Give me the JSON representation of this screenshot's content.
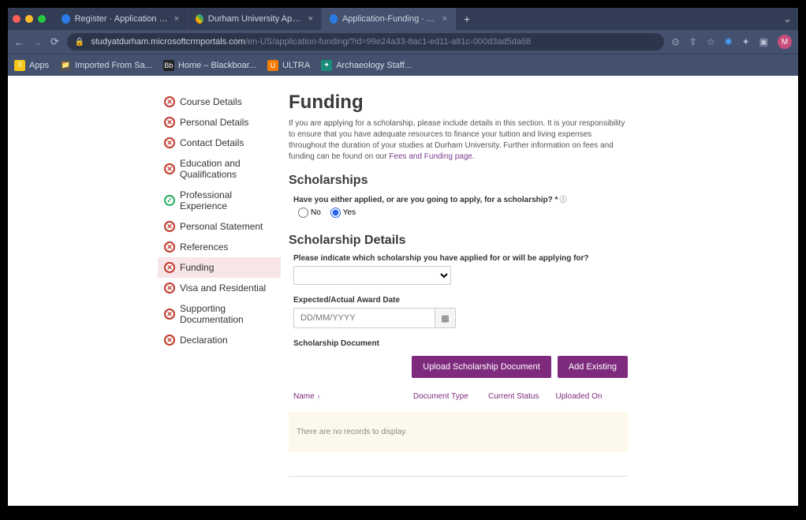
{
  "browser": {
    "tabs": [
      {
        "title": "Register · Application Portal",
        "active": false
      },
      {
        "title": "Durham University Applicant P",
        "active": false
      },
      {
        "title": "Application-Funding · Applicat",
        "active": true
      }
    ],
    "url_host": "studyatdurham.microsoftcrmportals.com",
    "url_path": "/en-US/application-funding/?id=99e24a33-8ac1-ed11-a81c-000d3ad5da68",
    "avatar_letter": "M",
    "bookmarks": [
      {
        "label": "Apps"
      },
      {
        "label": "Imported From Sa..."
      },
      {
        "label": "Home – Blackboar..."
      },
      {
        "label": "ULTRA"
      },
      {
        "label": "Archaeology Staff..."
      }
    ]
  },
  "sidebar": {
    "items": [
      {
        "label": "Course Details",
        "status": "err"
      },
      {
        "label": "Personal Details",
        "status": "err"
      },
      {
        "label": "Contact Details",
        "status": "err"
      },
      {
        "label": "Education and Qualifications",
        "status": "err"
      },
      {
        "label": "Professional Experience",
        "status": "ok"
      },
      {
        "label": "Personal Statement",
        "status": "err"
      },
      {
        "label": "References",
        "status": "err"
      },
      {
        "label": "Funding",
        "status": "err",
        "active": true
      },
      {
        "label": "Visa and Residential",
        "status": "err"
      },
      {
        "label": "Supporting Documentation",
        "status": "err"
      },
      {
        "label": "Declaration",
        "status": "err"
      }
    ]
  },
  "main": {
    "title": "Funding",
    "description": "If you are applying for a scholarship, please include details in this section. It is your responsibility to ensure that you have adequate resources to finance your tuition and living expenses throughout the duration of your studies at Durham University. Further information on fees and funding can be found on our ",
    "description_link": "Fees and Funding page",
    "section1_title": "Scholarships",
    "q1_label": "Have you either applied, or are you going to apply, for a scholarship? *",
    "q1_no": "No",
    "q1_yes": "Yes",
    "section2_title": "Scholarship Details",
    "q2_label": "Please indicate which scholarship you have applied for or will be applying for?",
    "date_label": "Expected/Actual Award Date",
    "date_placeholder": "DD/MM/YYYY",
    "doc_label": "Scholarship Document",
    "upload_btn": "Upload Scholarship Document",
    "add_btn": "Add Existing",
    "table": {
      "col_name": "Name",
      "col_type": "Document Type",
      "col_status": "Current Status",
      "col_uploaded": "Uploaded On",
      "empty": "There are no records to display."
    }
  }
}
